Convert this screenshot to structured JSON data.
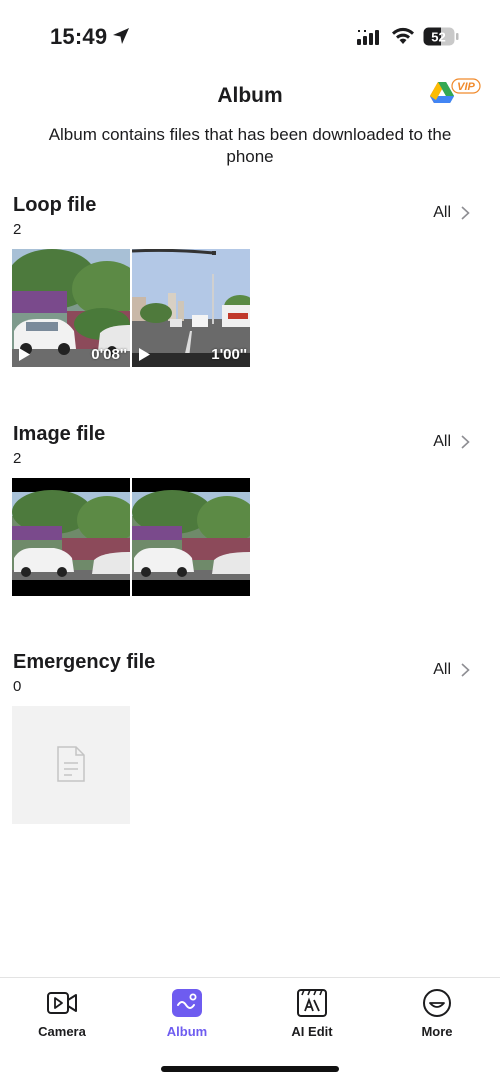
{
  "status_bar": {
    "time": "15:49",
    "battery": "52"
  },
  "header": {
    "title": "Album",
    "vip_badge": "VIP"
  },
  "subtitle": "Album contains files that has been downloaded to the phone",
  "sections": {
    "loop": {
      "title": "Loop file",
      "count": "2",
      "all_label": "All",
      "items": [
        {
          "duration": "0'08''"
        },
        {
          "duration": "1'00''"
        }
      ]
    },
    "image": {
      "title": "Image file",
      "count": "2",
      "all_label": "All"
    },
    "emergency": {
      "title": "Emergency file",
      "count": "0",
      "all_label": "All"
    }
  },
  "tabs": [
    {
      "label": "Camera",
      "icon": "video-camera-icon"
    },
    {
      "label": "Album",
      "icon": "album-icon",
      "active": true
    },
    {
      "label": "AI Edit",
      "icon": "ai-edit-icon"
    },
    {
      "label": "More",
      "icon": "smiley-icon"
    }
  ],
  "colors": {
    "accent": "#6e5cf0",
    "vip": "#f08a2c"
  }
}
